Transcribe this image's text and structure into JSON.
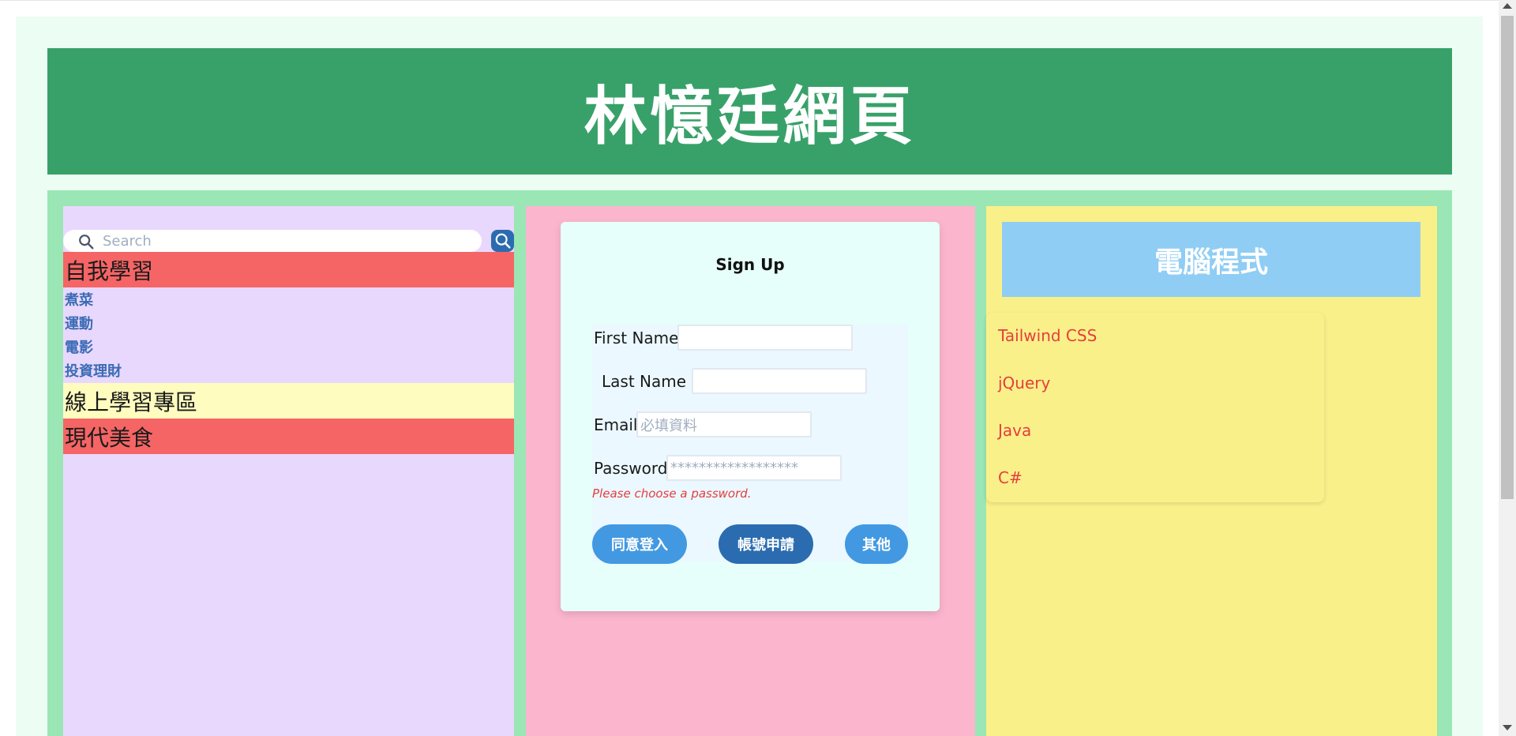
{
  "header": {
    "title": "林憶廷網頁"
  },
  "sidebar": {
    "search_placeholder": "Search",
    "sections": [
      {
        "label": "自我學習",
        "color": "#f56565"
      },
      {
        "label": "線上學習專區",
        "color": "#fefcbf"
      },
      {
        "label": "現代美食",
        "color": "#f56565"
      }
    ],
    "items": [
      "煮菜",
      "運動",
      "電影",
      "投資理財"
    ]
  },
  "signup": {
    "title": "Sign Up",
    "first_name_label": "First Name",
    "last_name_label": "Last Name",
    "email_label": "Email",
    "email_placeholder": "必填資料",
    "password_label": "Password",
    "password_placeholder": "******************",
    "error": "Please choose a password.",
    "buttons": [
      "同意登入",
      "帳號申請",
      "其他"
    ]
  },
  "right": {
    "banner": "電腦程式",
    "links": [
      "Tailwind CSS",
      "jQuery",
      "Java",
      "C#"
    ]
  },
  "colors": {
    "header": "#38a169",
    "main_bg": "#9ae6b4",
    "left_col": "#e9d8fd",
    "mid_col": "#fbb6ce",
    "right_col": "#faf089",
    "banner": "#90cdf4",
    "button_light": "#4299e1",
    "button_dark": "#2b6cb0"
  }
}
